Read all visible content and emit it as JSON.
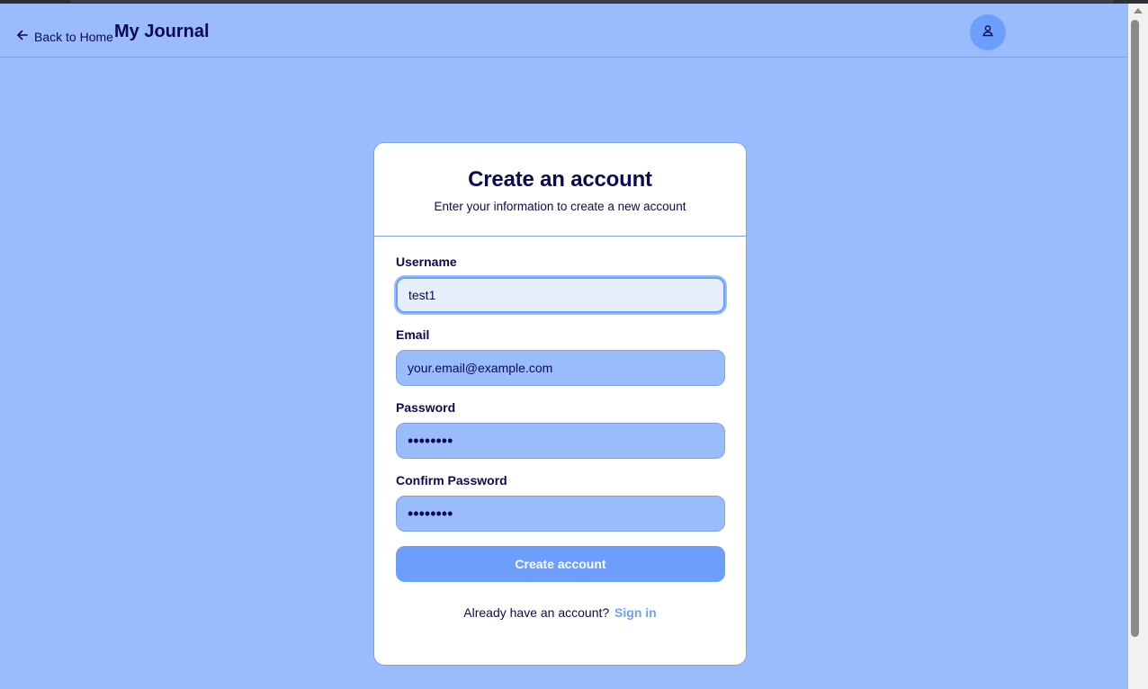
{
  "header": {
    "back_label": "Back to Home",
    "title": "My Journal",
    "avatar_icon": "user-icon"
  },
  "card": {
    "title": "Create an account",
    "subtitle": "Enter your information to create a new account"
  },
  "form": {
    "username": {
      "label": "Username",
      "value": "test1",
      "state": "focused"
    },
    "email": {
      "label": "Email",
      "placeholder": "your.email@example.com"
    },
    "password": {
      "label": "Password",
      "value": "••••••••"
    },
    "confirm_password": {
      "label": "Confirm Password",
      "value": "••••••••"
    },
    "submit_label": "Create account"
  },
  "footer": {
    "prompt": "Already have an account?",
    "link_label": "Sign in"
  },
  "colors": {
    "page_bg": "#9bbcfc",
    "accent": "#6e9efc",
    "text": "#0c0a4f",
    "border": "#7aa0ef"
  }
}
